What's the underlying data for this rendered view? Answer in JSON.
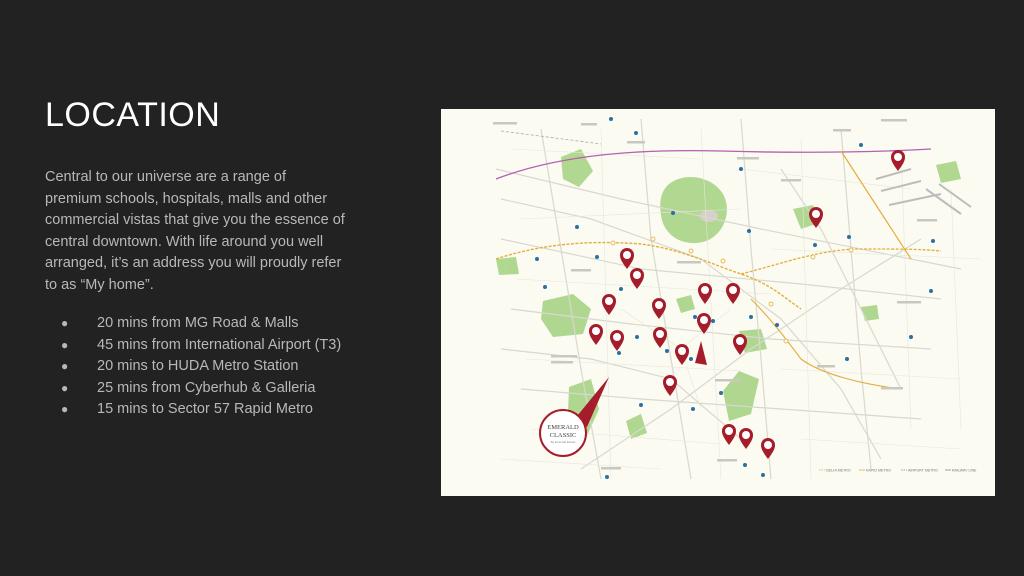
{
  "slide": {
    "title": "LOCATION",
    "intro": "Central to our universe are a range of premium schools, hospitals, malls and other commercial vistas that give you the essence of central downtown. With life around you well arranged, it’s an address you will proudly refer to as “My home”."
  },
  "highlights": [
    {
      "bullet": "●",
      "text": "20 mins from MG Road & Malls"
    },
    {
      "bullet": "●",
      "text": "45 mins from International Airport (T3)"
    },
    {
      "bullet": "●",
      "text": "20 mins to HUDA Metro Station"
    },
    {
      "bullet": "●",
      "text": "25 mins from Cyberhub & Galleria"
    },
    {
      "bullet": "●",
      "text": "15 mins to Sector 57 Rapid Metro"
    }
  ],
  "map": {
    "project": {
      "line1": "EMERALD",
      "line2": "CLASSIC",
      "tagline": "By Emerald Estate"
    },
    "legend": [
      {
        "label": "DELHI METRO",
        "color": "#e0a93a"
      },
      {
        "label": "RAPID METRO",
        "color": "#e0a93a"
      },
      {
        "label": "AIRPORT METRO",
        "color": "#8a8a8a"
      },
      {
        "label": "RAILWAY LINE",
        "color": "#8a8a8a"
      }
    ],
    "colors": {
      "background": "#fbfbf1",
      "park": "#9fd07a",
      "road": "#d6d6d0",
      "metro": "#e3ad3c",
      "railway": "#b75fb0",
      "marker": "#a51d2b",
      "poi": "#2a6fa5"
    },
    "markers": [
      {
        "icon": "school-icon"
      },
      {
        "icon": "hospital-icon"
      },
      {
        "icon": "school-icon"
      },
      {
        "icon": "mall-icon"
      },
      {
        "icon": "hospital-icon"
      },
      {
        "icon": "school-icon"
      },
      {
        "icon": "hospital-icon"
      },
      {
        "icon": "mall-icon"
      },
      {
        "icon": "school-icon"
      },
      {
        "icon": "school-icon"
      },
      {
        "icon": "hospital-icon"
      },
      {
        "icon": "mall-icon"
      },
      {
        "icon": "school-icon"
      },
      {
        "icon": "mall-icon"
      },
      {
        "icon": "school-icon"
      },
      {
        "icon": "airport-icon"
      },
      {
        "icon": "school-icon"
      },
      {
        "icon": "metro-icon"
      }
    ]
  }
}
